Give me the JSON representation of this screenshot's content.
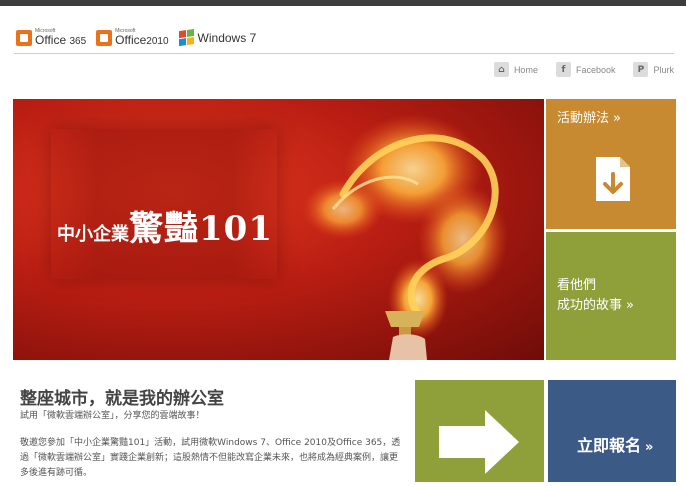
{
  "logos": {
    "office365": {
      "brand": "Microsoft",
      "product": "Office",
      "version": "365"
    },
    "office2010": {
      "brand": "Microsoft",
      "product": "Office",
      "version": "2010"
    },
    "windows7": {
      "product": "Windows",
      "version": "7"
    }
  },
  "nav": {
    "home": "Home",
    "facebook": "Facebook",
    "plurk": "Plurk"
  },
  "banner": {
    "title_small": "中小企業",
    "title_big": "驚豔101"
  },
  "tiles": {
    "rules": "活動辦法",
    "stories_line1": "看他們",
    "stories_line2": "成功的故事",
    "signup": "立即報名",
    "chevron": "»"
  },
  "content": {
    "headline": "整座城市，就是我的辦公室",
    "subline": "試用「微軟雲端辦公室」，分享您的雲端故事！",
    "body": "敬邀您參加「中小企業驚豔101」活動，試用微軟Windows 7、Office 2010及Office 365，透過「微軟雲端辦公室」實踐企業創新；這股熱情不但能改寫企業未來，也將成為經典案例，讓更多後進有跡可循。"
  },
  "colors": {
    "topbar": "#3d3d3d",
    "banner_red": "#b81d12",
    "orange_tile": "#c88a30",
    "green_tile": "#8fa03a",
    "blue_tile": "#3c5a86",
    "office_orange": "#e8731c"
  },
  "icons": {
    "home": "home-icon",
    "facebook": "facebook-icon",
    "plurk": "plurk-icon",
    "rules": "download-document-icon",
    "arrow": "arrow-right-icon"
  }
}
